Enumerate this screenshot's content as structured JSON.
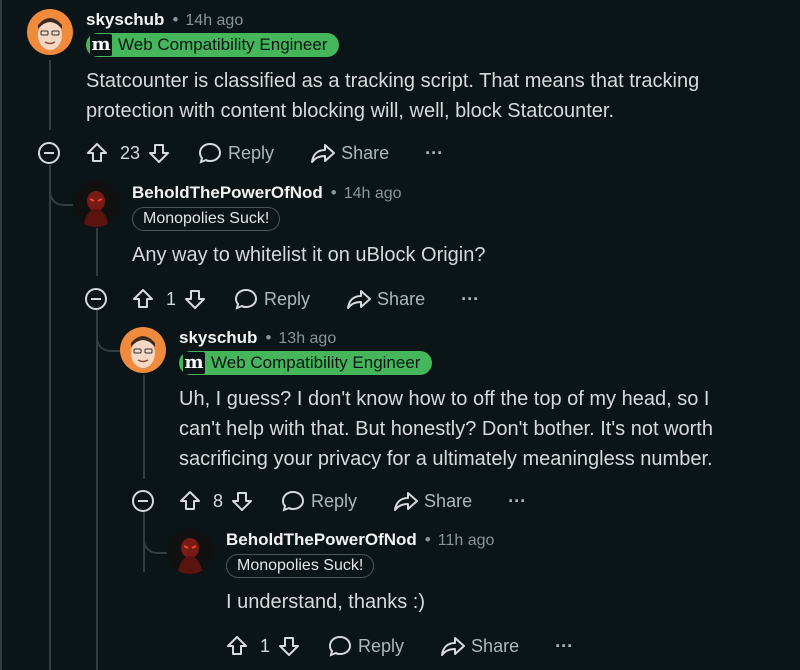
{
  "comments": [
    {
      "author": "skyschub",
      "time": "14h ago",
      "flair_letter": "m",
      "flair": "Web Compatibility Engineer",
      "lines": [
        "Statcounter is classified as a tracking script. That means that tracking",
        "protection with content blocking will, well, block Statcounter."
      ],
      "votes": "23",
      "reply": "Reply",
      "share": "Share",
      "more": "···"
    },
    {
      "author": "BeholdThePowerOfNod",
      "time": "14h ago",
      "flair": "Monopolies Suck!",
      "lines": [
        "Any way to whitelist it on uBlock Origin?"
      ],
      "votes": "1",
      "reply": "Reply",
      "share": "Share",
      "more": "···"
    },
    {
      "author": "skyschub",
      "time": "13h ago",
      "flair_letter": "m",
      "flair": "Web Compatibility Engineer",
      "lines": [
        "Uh, I guess? I don't know how to off the top of my head, so I",
        "can't help with that. But honestly? Don't bother. It's not worth",
        "sacrificing your privacy for a ultimately meaningless number."
      ],
      "votes": "8",
      "reply": "Reply",
      "share": "Share",
      "more": "···"
    },
    {
      "author": "BeholdThePowerOfNod",
      "time": "11h ago",
      "flair": "Monopolies Suck!",
      "lines": [
        "I understand, thanks :)"
      ],
      "votes": "1",
      "reply": "Reply",
      "share": "Share",
      "more": "···"
    }
  ],
  "colors": {
    "background": "#0b1416",
    "flair_green": "#46b65a",
    "text": "#d7dadc",
    "muted": "#8a9499"
  },
  "icons": [
    "upvote-icon",
    "downvote-icon",
    "reply-bubble-icon",
    "share-arrow-icon",
    "collapse-icon",
    "more-icon"
  ]
}
